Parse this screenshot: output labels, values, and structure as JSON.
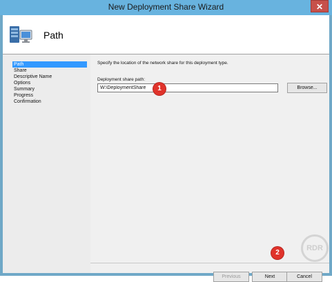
{
  "window": {
    "title": "New Deployment Share Wizard",
    "close_glyph": "✕"
  },
  "header": {
    "title": "Path",
    "icon": "deployment-share-icon"
  },
  "sidebar": {
    "items": [
      {
        "label": "Path",
        "active": true
      },
      {
        "label": "Share",
        "active": false
      },
      {
        "label": "Descriptive Name",
        "active": false
      },
      {
        "label": "Options",
        "active": false
      },
      {
        "label": "Summary",
        "active": false
      },
      {
        "label": "Progress",
        "active": false
      },
      {
        "label": "Confirmation",
        "active": false
      }
    ]
  },
  "main": {
    "instruction": "Specify the location of the network share for this deployment type.",
    "path_label": "Deployment share path:",
    "path_value": "W:\\DeploymentShare",
    "browse_label": "Browse..."
  },
  "annotations": {
    "badge1": "1",
    "badge2": "2"
  },
  "buttons": {
    "previous": "Previous",
    "next": "Next",
    "cancel": "Cancel"
  },
  "watermark": "RDR",
  "colors": {
    "titlebar": "#68b3df",
    "nav_active": "#3399ff",
    "badge": "#e0332b",
    "close": "#c7504a"
  }
}
